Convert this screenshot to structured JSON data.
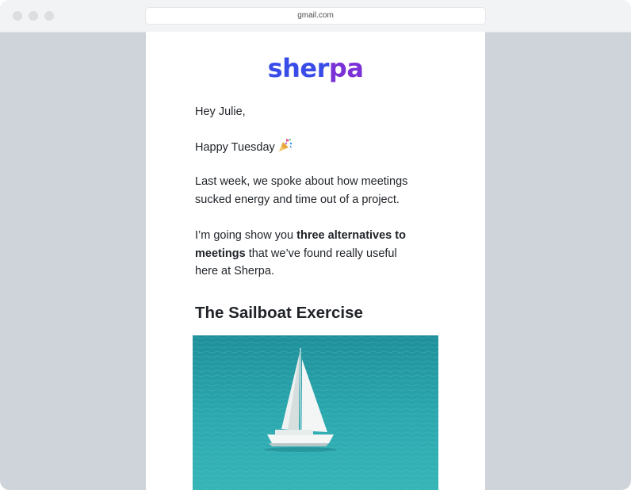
{
  "browser": {
    "url": "gmail.com"
  },
  "email": {
    "logo_part1": "sher",
    "logo_part2": "pa",
    "greeting": "Hey Julie,",
    "line_tuesday": "Happy Tuesday",
    "para_lastweek": "Last week, we spoke about how meetings sucked energy and time out of a project.",
    "para_alt_prefix": "I’m going show you ",
    "para_alt_bold": "three alternatives to meetings",
    "para_alt_suffix": " that we’ve found really useful here at Sherpa.",
    "section_title": "The Sailboat Exercise"
  },
  "colors": {
    "logo_blue": "#3a4ce8",
    "logo_purple": "#7a31d6",
    "window_bg": "#cfd4db",
    "sea": "#2aa3aa"
  },
  "icons": {
    "party": "party-popper-icon"
  }
}
